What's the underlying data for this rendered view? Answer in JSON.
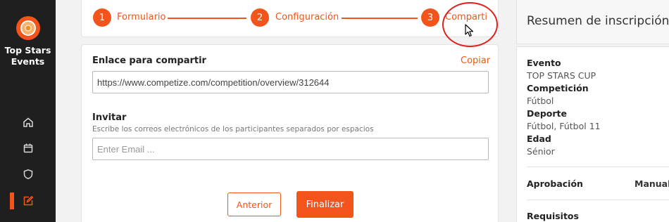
{
  "brand": {
    "name_line1": "Top Stars",
    "name_line2": "Events",
    "logo_icon": "medal-icon"
  },
  "nav": {
    "items": [
      {
        "id": "home",
        "icon": "home-icon"
      },
      {
        "id": "calendar",
        "icon": "calendar-icon"
      },
      {
        "id": "shield",
        "icon": "shield-icon"
      },
      {
        "id": "edit",
        "icon": "edit-icon",
        "active": true
      }
    ]
  },
  "stepper": {
    "steps": [
      {
        "number": "1",
        "label": "Formulario"
      },
      {
        "number": "2",
        "label": "Configuración"
      },
      {
        "number": "3",
        "label": "Compartir"
      }
    ]
  },
  "share": {
    "link_label": "Enlace para compartir",
    "copy_label": "Copiar",
    "link_value": "https://www.competize.com/competition/overview/312644",
    "invite_label": "Invitar",
    "invite_hint": "Escribe los correos electrónicos de los participantes separados por espacios",
    "email_placeholder": "Enter Email ...",
    "prev_label": "Anterior",
    "finish_label": "Finalizar"
  },
  "summary": {
    "title": "Resumen de inscripción",
    "event_key": "Evento",
    "event_value": "TOP STARS CUP",
    "competition_key": "Competición",
    "competition_value": "Fútbol",
    "sport_key": "Deporte",
    "sport_value": "Fútbol, Fútbol 11",
    "age_key": "Edad",
    "age_value": "Sénior",
    "approval_key": "Aprobación",
    "approval_value": "Manual",
    "requirements_key": "Requisitos"
  },
  "colors": {
    "accent": "#f2541b",
    "sidebar_bg": "#1f1f1f",
    "highlight_circle": "#e0201c"
  }
}
